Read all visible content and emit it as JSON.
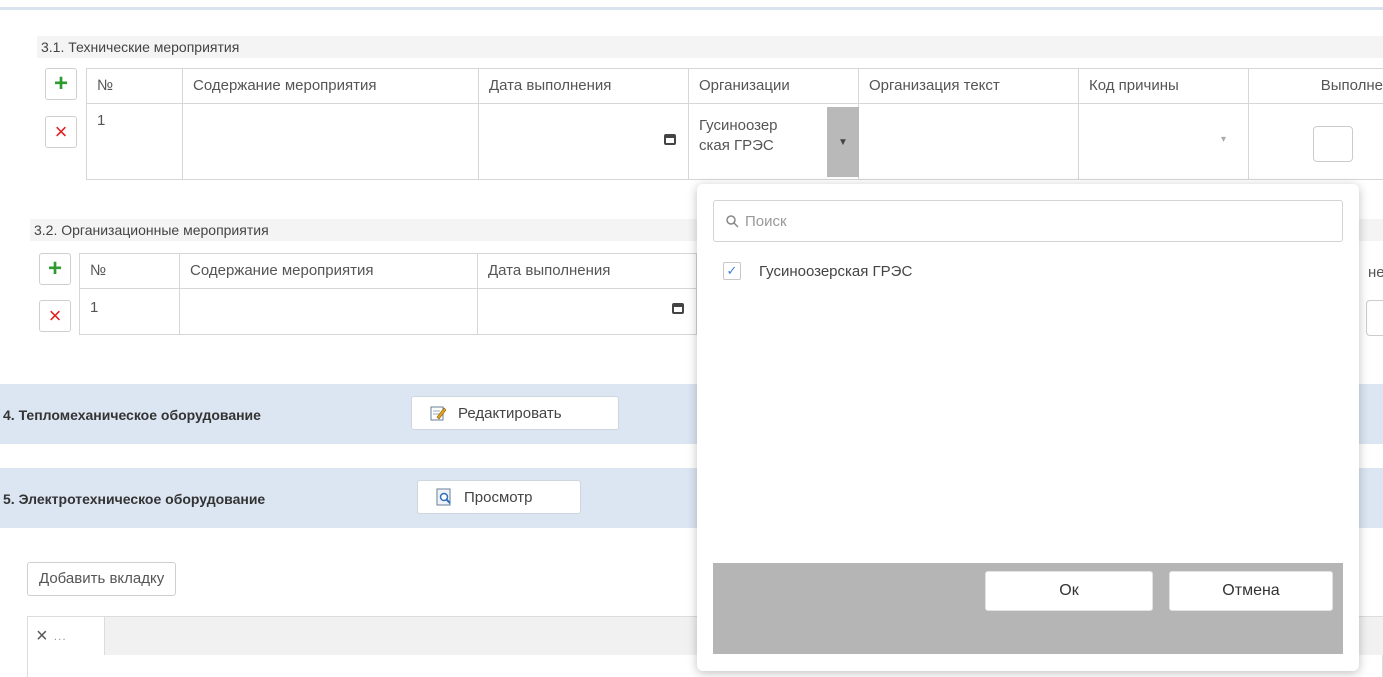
{
  "section_3_1": {
    "title": "3.1. Технические мероприятия",
    "headers": [
      "№",
      "Содержание мероприятия",
      "Дата выполнения",
      "Организации",
      "Организация текст",
      "Код причины",
      "Выполне"
    ],
    "row": {
      "num": "1",
      "content": "",
      "org": "Гусиноозерская ГРЭС",
      "org_line1": "Гусиноозер",
      "org_line2": "ская ГРЭС",
      "org_text": "",
      "reason": ""
    }
  },
  "section_3_2": {
    "title": "3.2. Организационные мероприятия",
    "headers": [
      "№",
      "Содержание мероприятия",
      "Дата выполнения"
    ],
    "header_tail": "не",
    "row": {
      "num": "1"
    }
  },
  "section_4": {
    "title": "4. Тепломеханическое оборудование",
    "button_label": "Редактировать"
  },
  "section_5": {
    "title": "5. Электротехническое оборудование",
    "button_label": "Просмотр"
  },
  "add_tab_label": "Добавить вкладку",
  "tab_close": "×",
  "tab_dots": "...",
  "popup": {
    "search_placeholder": "Поиск",
    "options": [
      {
        "label": "Гусиноозерская ГРЭС",
        "checked": true
      }
    ],
    "ok_label": "Ок",
    "cancel_label": "Отмена"
  },
  "colors": {
    "band": "#dce6f2",
    "plus": "#2e9b2e",
    "delete": "#e02020",
    "checkmark": "#3d7fd6",
    "popup_footer": "#b5b5b5"
  }
}
